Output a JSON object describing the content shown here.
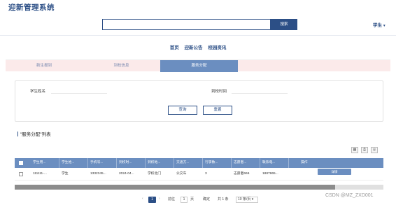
{
  "header": {
    "app_title": "迎新管理系统",
    "search_value": "",
    "search_button": "搜索",
    "user_label": "学生",
    "user_caret": "▾"
  },
  "nav": {
    "items": [
      "首页",
      "迎新公告",
      "校园资讯"
    ]
  },
  "tabs": [
    {
      "label": "新生报到",
      "active": false
    },
    {
      "label": "到校信息",
      "active": false
    },
    {
      "label": "服务分配",
      "active": true
    }
  ],
  "filter": {
    "student_name_label": "学生姓名",
    "student_name_value": "",
    "arrival_time_label": "到校时间",
    "arrival_time_value": "",
    "query_button": "查询",
    "reset_button": "重置"
  },
  "list": {
    "title": "\"服务分配\"列表",
    "toolbar_icons": [
      "refresh-icon",
      "print-icon",
      "settings-icon"
    ]
  },
  "table": {
    "headers": [
      "学生用...",
      "学生姓...",
      "手机号...",
      "到校时...",
      "到校地...",
      "交通方...",
      "行李数...",
      "志愿者...",
      "联系电...",
      "操作"
    ],
    "rows": [
      {
        "cells": [
          "111111-...",
          "学生",
          "1332345...",
          "2024-04...",
          "学校北门",
          "公交车",
          "3",
          "志愿者666",
          "1887865..."
        ],
        "action": "详情"
      }
    ]
  },
  "pagination": {
    "prev": "‹",
    "current_page": "1",
    "next": "›",
    "goto_label": "前往",
    "goto_value": "1",
    "page_unit": "页",
    "confirm": "确定",
    "total": "共 1 条",
    "page_size": "10 条/页 ▾"
  },
  "watermark": "CSDN @MZ_ZXD001",
  "colors": {
    "primary": "#2c4f86",
    "accent": "#6b8ec0",
    "tab_bg": "#fbeaea"
  }
}
